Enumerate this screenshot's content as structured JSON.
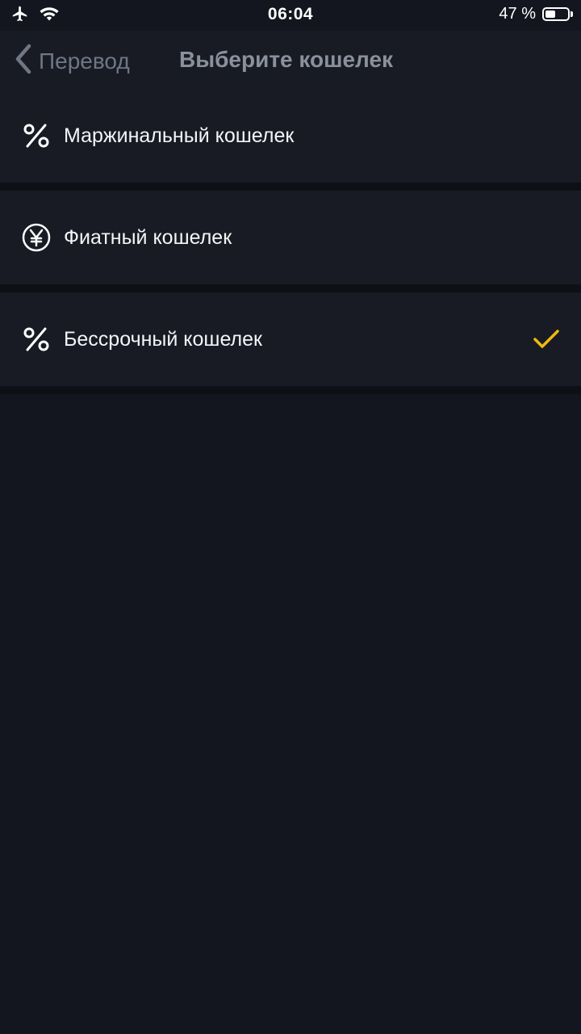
{
  "status_bar": {
    "time": "06:04",
    "battery_text": "47 %",
    "battery_level": 0.47,
    "icons": [
      "airplane-icon",
      "wifi-icon",
      "battery-icon"
    ]
  },
  "nav": {
    "back_label": "Перевод",
    "title": "Выберите кошелек"
  },
  "wallets": [
    {
      "label": "Маржинальный кошелек",
      "icon": "percent-icon",
      "selected": false
    },
    {
      "label": "Фиатный кошелек",
      "icon": "yen-circle-icon",
      "selected": false
    },
    {
      "label": "Бессрочный кошелек",
      "icon": "percent-icon",
      "selected": true
    }
  ],
  "colors": {
    "background": "#13161e",
    "row_background": "#181b24",
    "accent_check": "#f0b90b"
  }
}
